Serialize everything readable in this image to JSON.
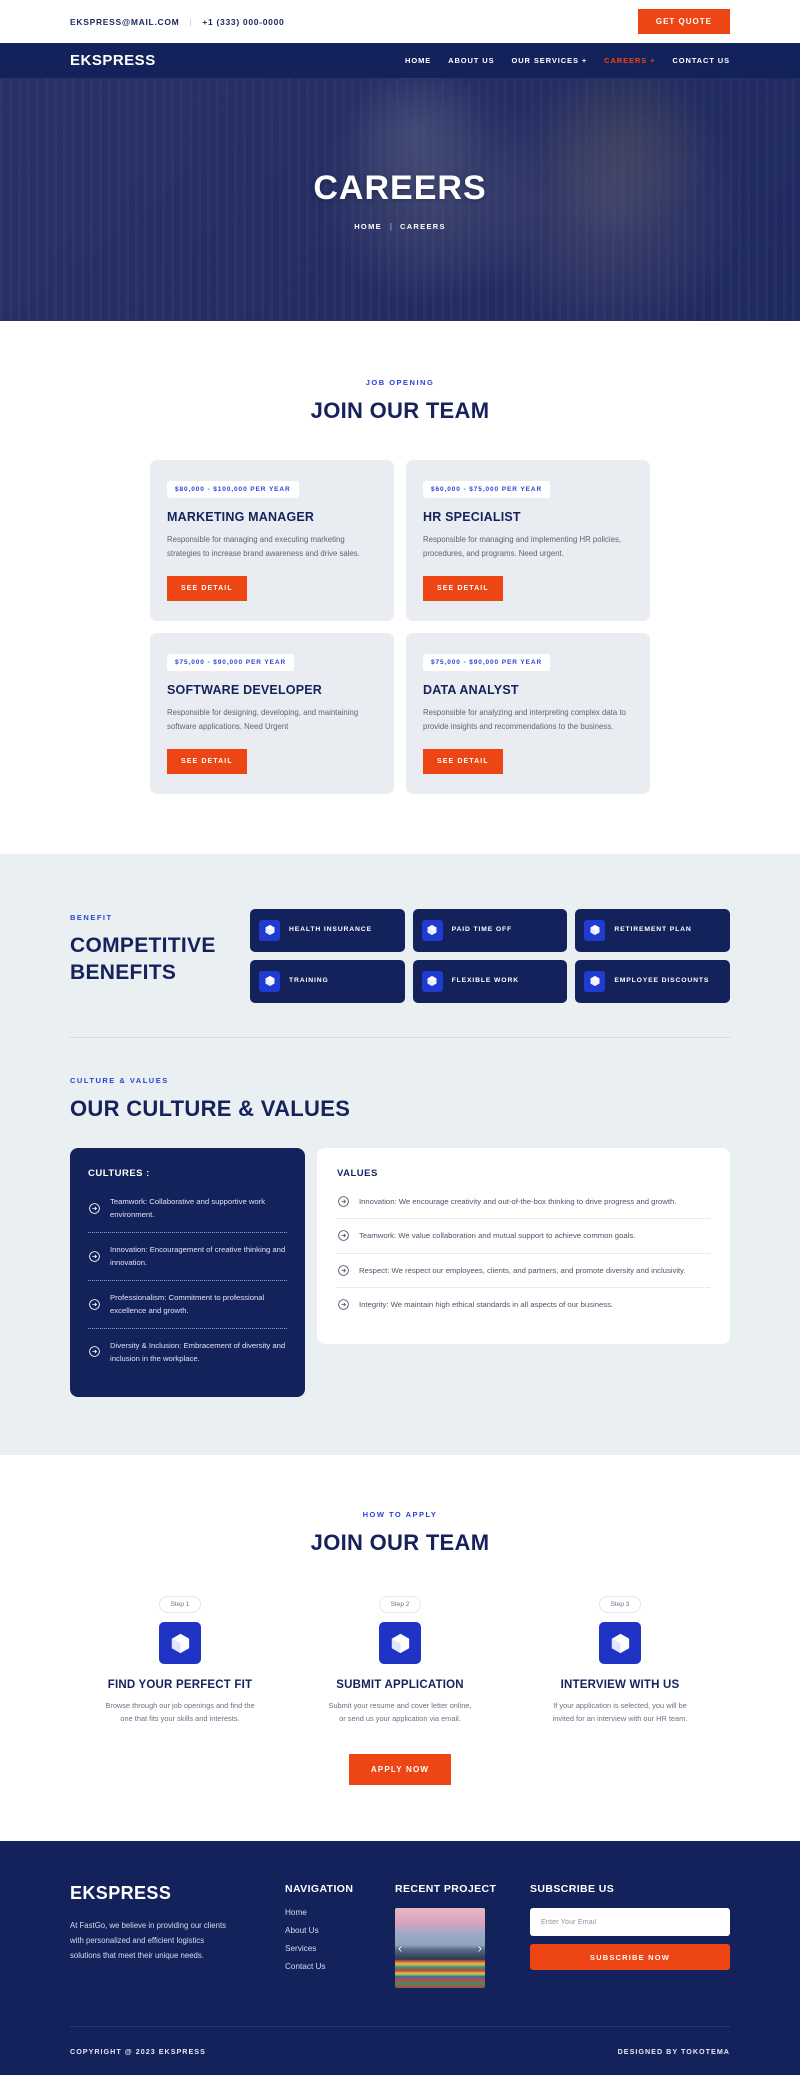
{
  "topbar": {
    "email": "EKSPRESS@MAIL.COM",
    "separator": "|",
    "phone": "+1 (333) 000-0000",
    "quote_label": "GET QUOTE"
  },
  "nav": {
    "brand": "EKSPRESS",
    "items": [
      {
        "label": "HOME",
        "active": false,
        "plus": ""
      },
      {
        "label": "ABOUT US",
        "active": false,
        "plus": ""
      },
      {
        "label": "OUR SERVICES",
        "active": false,
        "plus": "+"
      },
      {
        "label": "CAREERS",
        "active": true,
        "plus": "+"
      },
      {
        "label": "CONTACT US",
        "active": false,
        "plus": ""
      }
    ]
  },
  "hero": {
    "title": "CAREERS",
    "crumb_home": "HOME",
    "crumb_sep": "|",
    "crumb_current": "CAREERS"
  },
  "jobs": {
    "eyebrow": "JOB OPENING",
    "title": "JOIN OUR TEAM",
    "cards": [
      {
        "salary": "$80,000 - $100,000 PER YEAR",
        "title": "MARKETING MANAGER",
        "desc": "Responsible for managing and executing marketing strategies to increase brand awareness and drive sales.",
        "cta": "SEE DETAIL"
      },
      {
        "salary": "$60,000 - $75,000 PER YEAR",
        "title": "HR SPECIALIST",
        "desc": "Responsible for managing and implementing HR policies, procedures, and programs. Need urgent.",
        "cta": "SEE DETAIL"
      },
      {
        "salary": "$75,000 - $90,000 PER YEAR",
        "title": "SOFTWARE DEVELOPER",
        "desc": "Responsible for designing, developing, and maintaining software applications. Need Urgent",
        "cta": "SEE DETAIL"
      },
      {
        "salary": "$75,000 - $90,000 PER YEAR",
        "title": "DATA ANALYST",
        "desc": "Responsible for analyzing and interpreting complex data to provide insights and recommendations to the business.",
        "cta": "SEE DETAIL"
      }
    ]
  },
  "benefits": {
    "eyebrow": "BENEFIT",
    "title_line1": "COMPETITIVE",
    "title_line2": "BENEFITS",
    "items": [
      {
        "label": "HEALTH INSURANCE",
        "icon": "cube-icon"
      },
      {
        "label": "PAID TIME OFF",
        "icon": "cube-icon"
      },
      {
        "label": "RETIREMENT PLAN",
        "icon": "cube-icon"
      },
      {
        "label": "TRAINING",
        "icon": "cube-icon"
      },
      {
        "label": "FLEXIBLE WORK",
        "icon": "cube-icon"
      },
      {
        "label": "EMPLOYEE DISCOUNTS",
        "icon": "cube-icon"
      }
    ]
  },
  "culture": {
    "eyebrow": "CULTURE & VALUES",
    "title": "OUR CULTURE & VALUES",
    "cultures_heading": "CULTURES :",
    "cultures": [
      "Teamwork: Collaborative and supportive work environment.",
      "Innovation: Encouragement of creative thinking and innovation.",
      "Professionalism: Commitment to professional excellence and growth.",
      "Diversity & Inclusion: Embracement of diversity and inclusion in the workplace."
    ],
    "values_heading": "VALUES",
    "values": [
      "Innovation: We encourage creativity and out-of-the-box thinking to drive progress and growth.",
      "Teamwork: We value collaboration and mutual support to achieve common goals.",
      "Respect: We respect our employees, clients, and partners, and promote diversity and inclusivity.",
      "Integrity: We maintain high ethical standards in all aspects of our business."
    ]
  },
  "apply": {
    "eyebrow": "HOW TO APPLY",
    "title": "JOIN OUR TEAM",
    "steps": [
      {
        "pill": "Step 1",
        "title": "FIND YOUR PERFECT FIT",
        "desc": "Browse through our job openings and find the one that fits your skills and interests.",
        "icon": "cube-icon"
      },
      {
        "pill": "Step 2",
        "title": "SUBMIT APPLICATION",
        "desc": "Submit your resume and cover letter online, or send us your application via email.",
        "icon": "cube-icon"
      },
      {
        "pill": "Step 3",
        "title": "INTERVIEW WITH US",
        "desc": "If your application is selected, you will be invited for an interview with our HR team.",
        "icon": "cube-icon"
      }
    ],
    "cta": "APPLY NOW"
  },
  "footer": {
    "brand": "EKSPRESS",
    "about": "At FastGo, we believe in providing our clients with personalized and efficient logistics solutions that meet their unique needs.",
    "nav_heading": "NAVIGATION",
    "nav_links": [
      "Home",
      "About Us",
      "Services",
      "Contact Us"
    ],
    "project_heading": "RECENT PROJECT",
    "project_prev": "‹",
    "project_next": "›",
    "subscribe_heading": "SUBSCRIBE US",
    "email_placeholder": "Enter Your Email",
    "email_value": "",
    "subscribe_label": "SUBSCRIBE NOW",
    "copyright": "COPYRIGHT @ 2023 EKSPRESS",
    "designed_by": "DESIGNED BY TOKOTEMA"
  },
  "colors": {
    "navy": "#14225c",
    "orange": "#ee4514",
    "blue": "#1f34c4",
    "accent_blue": "#2a44d8",
    "band": "#eaeff2",
    "card": "#e9edf1"
  }
}
